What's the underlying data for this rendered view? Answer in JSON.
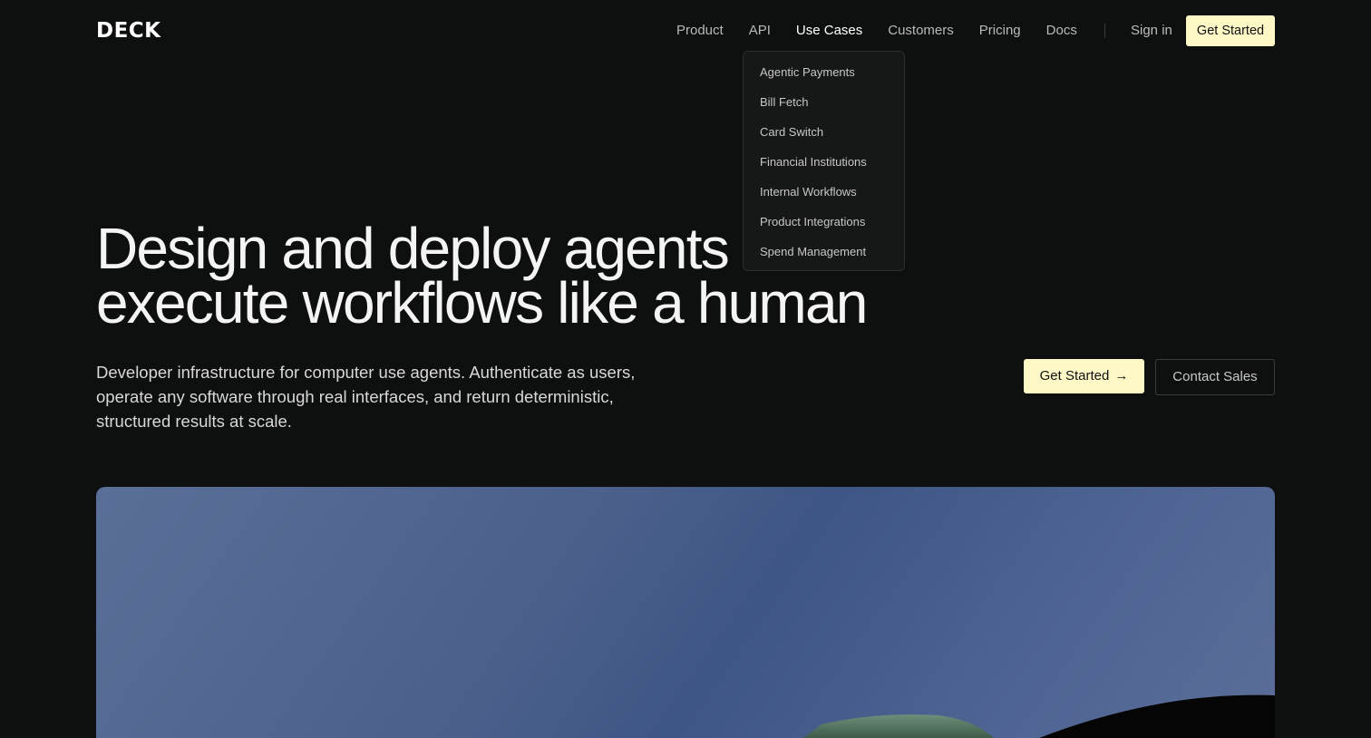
{
  "brand": {
    "logo_text": "DECK"
  },
  "nav": {
    "items": [
      {
        "label": "Product"
      },
      {
        "label": "API"
      },
      {
        "label": "Use Cases",
        "active": true
      },
      {
        "label": "Customers"
      },
      {
        "label": "Pricing"
      },
      {
        "label": "Docs"
      }
    ],
    "sign_in": "Sign in",
    "cta": "Get Started"
  },
  "use_cases_dropdown": {
    "items": [
      "Agentic Payments",
      "Bill Fetch",
      "Card Switch",
      "Financial Institutions",
      "Internal Workflows",
      "Product Integrations",
      "Spend Management"
    ]
  },
  "hero": {
    "title_line1": "Design and deploy agents that",
    "title_line2": "execute workflows like a human",
    "subtitle_line1": "Developer infrastructure for computer use agents. Authenticate as users,",
    "subtitle_line2": "operate any software through real interfaces, and return deterministic,",
    "subtitle_line3": "structured results at scale.",
    "primary_cta": "Get Started",
    "primary_cta_icon": "arrow-right-icon",
    "secondary_cta": "Contact Sales"
  },
  "colors": {
    "background": "#0e0f0f",
    "accent": "#fdf8c6",
    "panel_blue": "#4a5f8a"
  }
}
